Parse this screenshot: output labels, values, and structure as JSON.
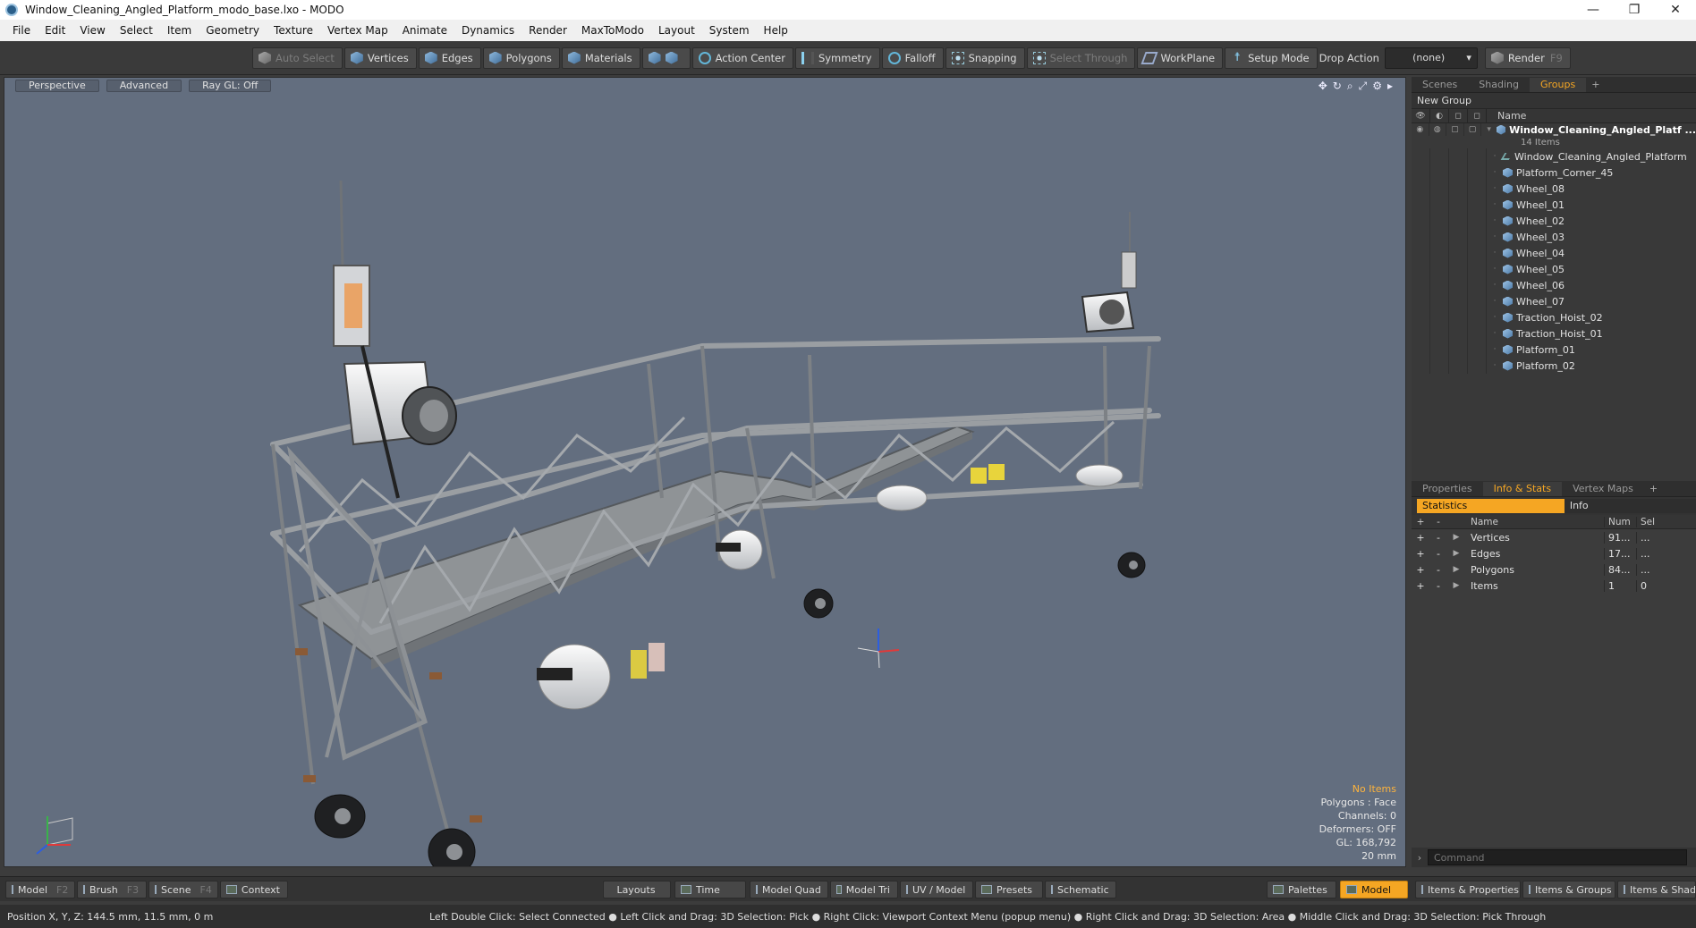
{
  "window": {
    "title": "Window_Cleaning_Angled_Platform_modo_base.lxo - MODO",
    "minimize": "—",
    "restore": "❐",
    "close": "✕"
  },
  "menu": [
    "File",
    "Edit",
    "View",
    "Select",
    "Item",
    "Geometry",
    "Texture",
    "Vertex Map",
    "Animate",
    "Dynamics",
    "Render",
    "MaxToModo",
    "Layout",
    "System",
    "Help"
  ],
  "toolbar": {
    "auto_select": "Auto Select",
    "vertices": "Vertices",
    "edges": "Edges",
    "polygons": "Polygons",
    "materials": "Materials",
    "action_center": "Action Center",
    "symmetry": "Symmetry",
    "falloff": "Falloff",
    "snapping": "Snapping",
    "select_through": "Select Through",
    "workplane": "WorkPlane",
    "setup_mode": "Setup Mode",
    "drop_action": "Drop Action",
    "drop_value": "(none)",
    "render": "Render",
    "render_key": "F9"
  },
  "viewport": {
    "view": "Perspective",
    "shading": "Advanced",
    "raygl": "Ray GL: Off",
    "hud": {
      "items": "No Items",
      "polygons": "Polygons : Face",
      "channels": "Channels: 0",
      "deformers": "Deformers: OFF",
      "gl": "GL: 168,792",
      "scale": "20 mm"
    }
  },
  "groups_panel": {
    "tabs": [
      "Scenes",
      "Shading",
      "Groups"
    ],
    "new_group": "New Group",
    "col_name": "Name",
    "root": {
      "name": "Window_Cleaning_Angled_Platf ...",
      "count": "14 Items"
    },
    "items": [
      "Window_Cleaning_Angled_Platform",
      "Platform_Corner_45",
      "Wheel_08",
      "Wheel_01",
      "Wheel_02",
      "Wheel_03",
      "Wheel_04",
      "Wheel_05",
      "Wheel_06",
      "Wheel_07",
      "Traction_Hoist_02",
      "Traction_Hoist_01",
      "Platform_01",
      "Platform_02"
    ]
  },
  "props_panel": {
    "tabs": [
      "Properties",
      "Info & Stats",
      "Vertex Maps"
    ],
    "sub_tabs": [
      "Statistics",
      "Info"
    ],
    "cols": {
      "name": "Name",
      "num": "Num",
      "sel": "Sel"
    },
    "rows": [
      {
        "name": "Vertices",
        "num": "91...",
        "sel": "..."
      },
      {
        "name": "Edges",
        "num": "17...",
        "sel": "..."
      },
      {
        "name": "Polygons",
        "num": "84...",
        "sel": "..."
      },
      {
        "name": "Items",
        "num": "1",
        "sel": "0"
      }
    ],
    "command_placeholder": "Command"
  },
  "bottom": {
    "model": "Model",
    "model_key": "F2",
    "brush": "Brush",
    "brush_key": "F3",
    "scene": "Scene",
    "scene_key": "F4",
    "context": "Context",
    "layouts": "Layouts",
    "time": "Time",
    "model_quad": "Model Quad",
    "model_tri": "Model Tri",
    "uv_model": "UV / Model",
    "presets": "Presets",
    "schematic": "Schematic",
    "palettes": "Palettes",
    "model_active": "Model",
    "items_props": "Items & Properties",
    "items_groups": "Items & Groups",
    "items_shading": "Items & Shadi"
  },
  "status": {
    "position": "Position X, Y, Z:   144.5 mm, 11.5 mm, 0 m",
    "hint": "Left Double Click: Select Connected ● Left Click and Drag: 3D Selection: Pick ● Right Click: Viewport Context Menu (popup menu) ● Right Click and Drag: 3D Selection: Area ● Middle Click and Drag: 3D Selection: Pick Through"
  },
  "colors": {
    "accent": "#f5a623",
    "viewport_bg": "#636e7f",
    "panel_bg": "#3c3c3c"
  }
}
